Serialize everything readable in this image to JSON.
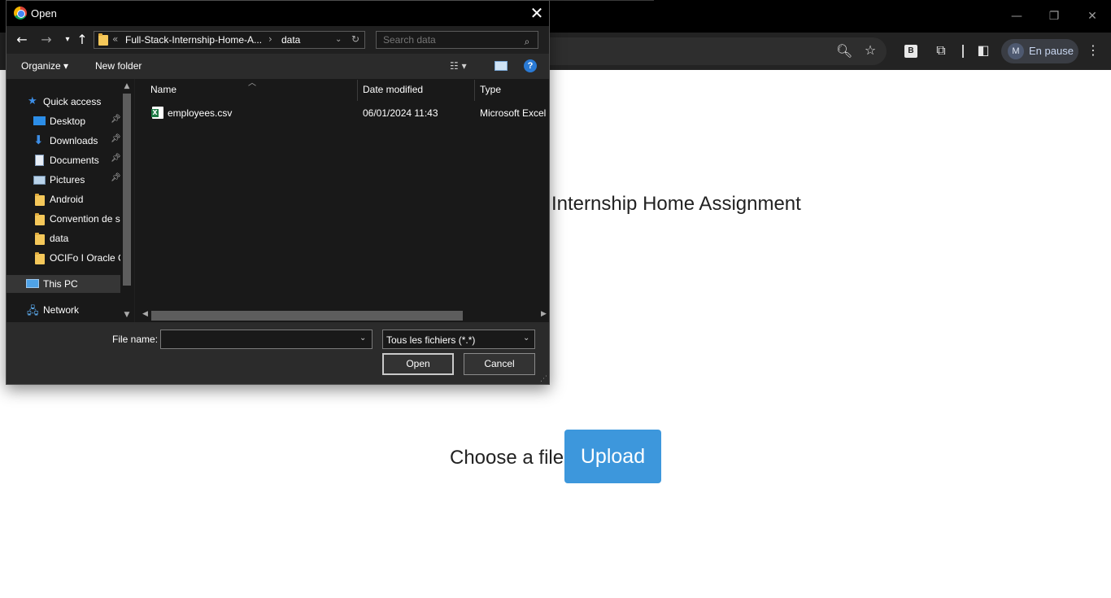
{
  "browser": {
    "profile_initial": "M",
    "profile_label": "En pause",
    "extension_badge": "B"
  },
  "page": {
    "heading": "Internship Home Assignment",
    "choose_label": "Choose a file:",
    "upload_label": "Upload",
    "upload_color": "#3d97dc"
  },
  "dialog": {
    "title": "Open",
    "breadcrumb": {
      "overflow": "«",
      "parent": "Full-Stack-Internship-Home-A...",
      "current": "data"
    },
    "search_placeholder": "Search data",
    "toolbar": {
      "organize": "Organize ▾",
      "new_folder": "New folder"
    },
    "nav_pane": {
      "quick_access": "Quick access",
      "items": [
        {
          "label": "Desktop",
          "icon": "desktop-icon",
          "pinned": true
        },
        {
          "label": "Downloads",
          "icon": "download-icon",
          "pinned": true
        },
        {
          "label": "Documents",
          "icon": "documents-icon",
          "pinned": true
        },
        {
          "label": "Pictures",
          "icon": "pictures-icon",
          "pinned": true
        },
        {
          "label": "Android",
          "icon": "folder-icon",
          "pinned": false
        },
        {
          "label": "Convention de s",
          "icon": "folder-icon",
          "pinned": false
        },
        {
          "label": "data",
          "icon": "folder-icon",
          "pinned": false
        },
        {
          "label": "OCIFo I Oracle C",
          "icon": "folder-icon",
          "pinned": false
        }
      ],
      "this_pc": "This PC",
      "network": "Network"
    },
    "columns": {
      "name": "Name",
      "date": "Date modified",
      "type": "Type"
    },
    "files": [
      {
        "name": "employees.csv",
        "date": "06/01/2024 11:43",
        "type": "Microsoft Excel"
      }
    ],
    "file_name_label": "File name:",
    "file_name_value": "",
    "file_type": "Tous les fichiers (*.*)",
    "open_button": "Open",
    "cancel_button": "Cancel"
  }
}
